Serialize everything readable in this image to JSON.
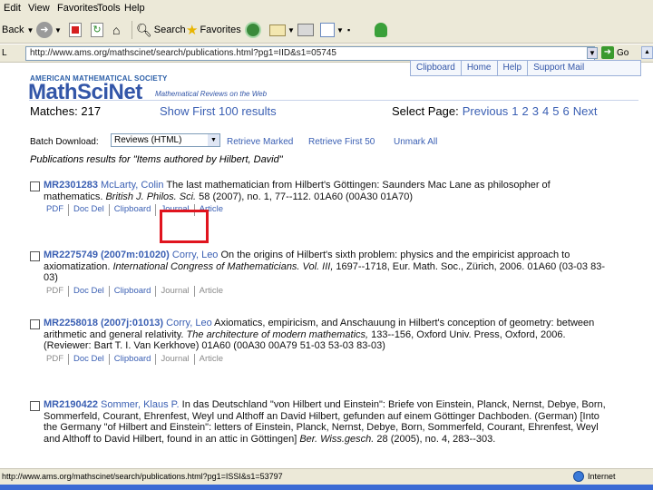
{
  "menu": [
    "Edit",
    "View",
    "Favorites",
    "Tools",
    "Help"
  ],
  "toolbar": {
    "back": "Back",
    "search": "Search",
    "favorites": "Favorites"
  },
  "address": {
    "url": "http://www.ams.org/mathscinet/search/publications.html?pg1=IID&s1=05745",
    "go": "Go",
    "links": "L"
  },
  "header": {
    "banner": "AMERICAN MATHEMATICAL SOCIETY",
    "logo": "MathSciNet",
    "tagline": "Mathematical Reviews on the Web",
    "nav": [
      "Clipboard",
      "Home",
      "Help",
      "Support Mail"
    ]
  },
  "matches": {
    "label": "Matches: 217",
    "show_first": "Show First 100 results",
    "select_page_label": "Select Page:",
    "previous": "Previous",
    "pages": [
      "1",
      "2",
      "3",
      "4",
      "5",
      "6"
    ],
    "next": "Next"
  },
  "batch": {
    "label": "Batch Download:",
    "selected": "Reviews (HTML)",
    "retrieve_marked": "Retrieve Marked",
    "retrieve_first": "Retrieve First 50",
    "unmark_all": "Unmark All"
  },
  "results_caption": "Publications results for \"Items authored by Hilbert, David\"",
  "entries": [
    {
      "mr": "MR2301283",
      "author": "McLarty, Colin",
      "text": " The last mathematician from Hilbert's Göttingen: Saunders Mac Lane as philosopher of mathematics. ",
      "journal": "British J. Philos. Sci.",
      "tail": " 58 (2007), no. 1, 77--112. 01A60 (00A30 01A70)",
      "links": [
        {
          "label": "PDF",
          "dim": false
        },
        {
          "label": "Doc Del",
          "dim": false
        },
        {
          "label": "Clipboard",
          "dim": false
        },
        {
          "label": "Journal",
          "dim": false
        },
        {
          "label": "Article",
          "dim": false
        }
      ]
    },
    {
      "mr": "MR2275749 (2007m:01020)",
      "author": "Corry, Leo",
      "text": " On the origins of Hilbert's sixth problem: physics and the empiricist approach to axiomatization. ",
      "journal": "International Congress of Mathematicians. Vol. III,",
      "tail": " 1697--1718, Eur. Math. Soc., Zürich, 2006. 01A60 (03-03 83-03)",
      "links": [
        {
          "label": "PDF",
          "dim": true
        },
        {
          "label": "Doc Del",
          "dim": false
        },
        {
          "label": "Clipboard",
          "dim": false
        },
        {
          "label": "Journal",
          "dim": true
        },
        {
          "label": "Article",
          "dim": true
        }
      ]
    },
    {
      "mr": "MR2258018 (2007j:01013)",
      "author": "Corry, Leo",
      "text": " Axiomatics, empiricism, and Anschauung in Hilbert's conception of geometry: between arithmetic and general relativity. ",
      "journal": "The architecture of modern mathematics,",
      "tail": " 133--156, Oxford Univ. Press, Oxford, 2006. (Reviewer: Bart T. I. Van Kerkhove) 01A60 (00A30 00A79 51-03 53-03 83-03)",
      "links": [
        {
          "label": "PDF",
          "dim": true
        },
        {
          "label": "Doc Del",
          "dim": false
        },
        {
          "label": "Clipboard",
          "dim": false
        },
        {
          "label": "Journal",
          "dim": true
        },
        {
          "label": "Article",
          "dim": true
        }
      ]
    },
    {
      "mr": "MR2190422",
      "author": "Sommer, Klaus P.",
      "text": " In das Deutschland \"von Hilbert und Einstein\": Briefe von Einstein, Planck, Nernst, Debye, Born, Sommerfeld, Courant, Ehrenfest, Weyl und Althoff an David Hilbert, gefunden auf einem Göttinger Dachboden. (German) [Into the Germany \"of Hilbert and Einstein\": letters of Einstein, Planck, Nernst, Debye, Born, Sommerfeld, Courant, Ehrenfest, Weyl and Althoff to David Hilbert, found in an attic in Göttingen] ",
      "journal": "Ber. Wiss.gesch.",
      "tail": " 28 (2005), no. 4, 283--303.",
      "links": []
    }
  ],
  "status": {
    "url": "http://www.ams.org/mathscinet/search/publications.html?pg1=ISSI&s1=53797",
    "zone": "Internet"
  }
}
